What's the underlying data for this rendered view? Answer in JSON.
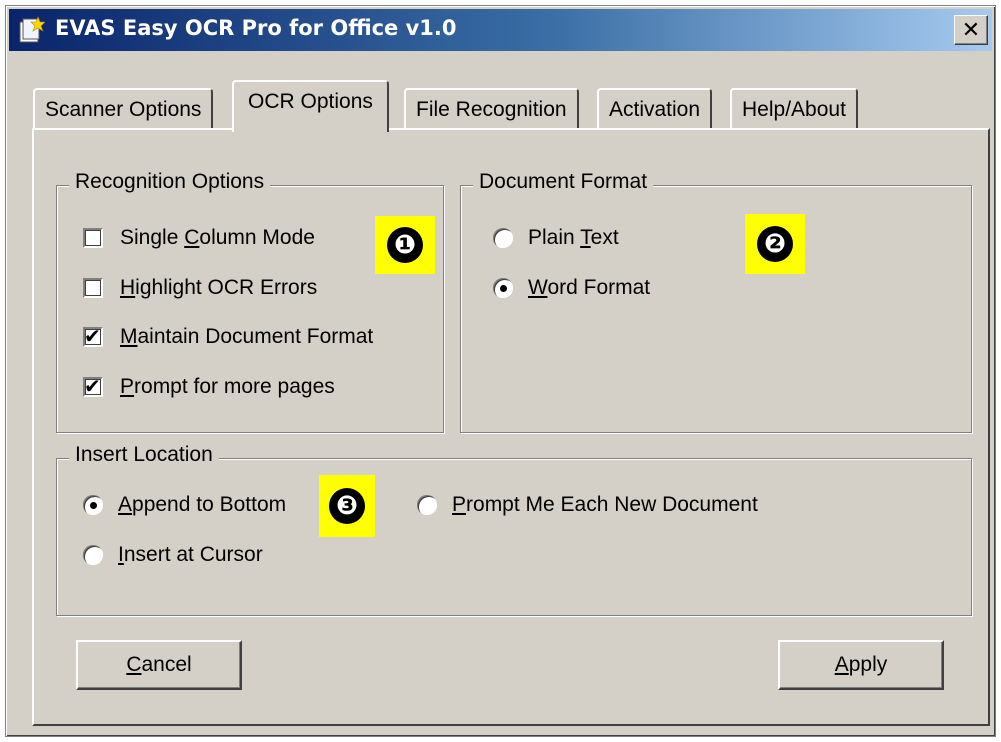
{
  "window": {
    "title": "EVAS Easy OCR Pro for Office v1.0",
    "close_glyph": "✕"
  },
  "tabs": [
    {
      "label": "Scanner Options",
      "active": false
    },
    {
      "label": "OCR Options",
      "active": true
    },
    {
      "label": "File Recognition",
      "active": false
    },
    {
      "label": "Activation",
      "active": false
    },
    {
      "label": "Help/About",
      "active": false
    }
  ],
  "recognition_options": {
    "legend": "Recognition Options",
    "items": [
      {
        "pre": "Single ",
        "ul": "C",
        "post": "olumn Mode",
        "checked": false
      },
      {
        "pre": "",
        "ul": "H",
        "post": "ighlight OCR Errors",
        "checked": false
      },
      {
        "pre": "",
        "ul": "M",
        "post": "aintain Document Format",
        "checked": true
      },
      {
        "pre": "",
        "ul": "P",
        "post": "rompt for more pages",
        "checked": true
      }
    ]
  },
  "document_format": {
    "legend": "Document Format",
    "options": [
      {
        "pre": "Plain ",
        "ul": "T",
        "post": "ext",
        "selected": false
      },
      {
        "pre": "",
        "ul": "W",
        "post": "ord Format",
        "selected": true
      }
    ]
  },
  "insert_location": {
    "legend": "Insert Location",
    "options": [
      {
        "pre": "",
        "ul": "A",
        "post": "ppend to Bottom",
        "selected": true
      },
      {
        "pre": "",
        "ul": "P",
        "post": "rompt Me Each New Document",
        "selected": false
      },
      {
        "pre": "",
        "ul": "I",
        "post": "nsert at Cursor",
        "selected": false
      }
    ]
  },
  "annotations": [
    "❶",
    "❷",
    "❸"
  ],
  "buttons": {
    "cancel": {
      "ul": "C",
      "post": "ancel"
    },
    "apply": {
      "ul": "A",
      "post": "pply"
    }
  },
  "colors": {
    "dialog_bg": "#d4d0c8",
    "title_gradient_start": "#0a246a",
    "title_gradient_end": "#a6caf0",
    "annotation_highlight": "#ffff00"
  }
}
